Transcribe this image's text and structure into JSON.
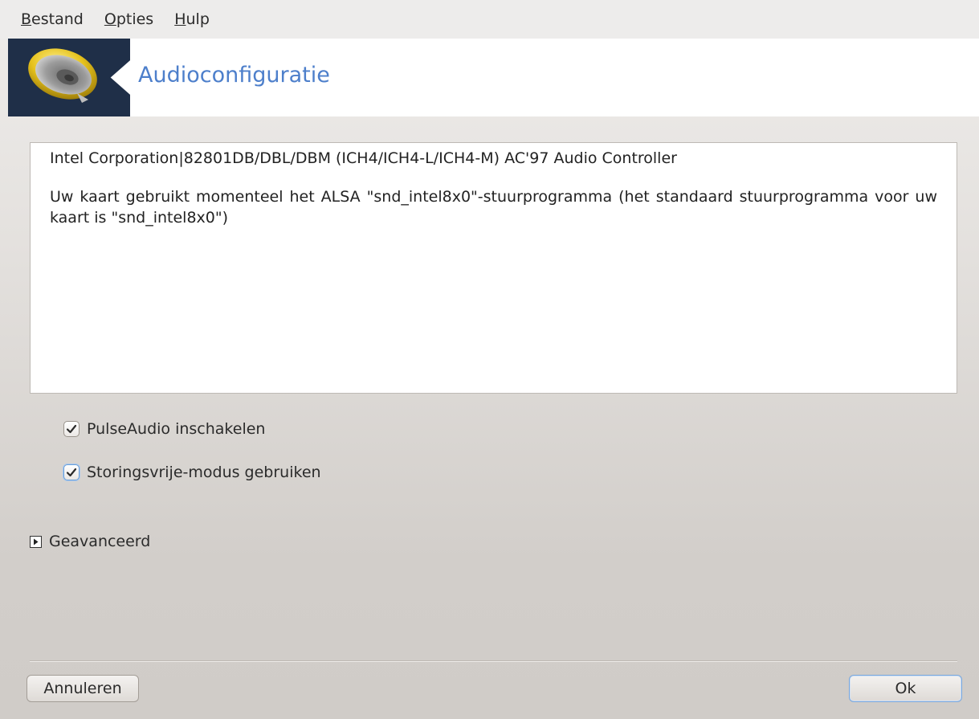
{
  "menubar": {
    "items": [
      {
        "mnemonic": "B",
        "rest": "estand"
      },
      {
        "mnemonic": "O",
        "rest": "pties"
      },
      {
        "mnemonic": "H",
        "rest": "ulp"
      }
    ]
  },
  "header": {
    "title": "Audioconfiguratie",
    "icon": "speaker-icon"
  },
  "info": {
    "card_name": "Intel Corporation|82801DB/DBL/DBM (ICH4/ICH4-L/ICH4-M) AC'97 Audio Controller",
    "description": "Uw kaart gebruikt momenteel het ALSA \"snd_intel8x0\"-stuurprogramma (het standaard stuurprogramma voor uw kaart is \"snd_intel8x0\")"
  },
  "options": {
    "pulseaudio": {
      "label": "PulseAudio inschakelen",
      "checked": true
    },
    "glitchfree": {
      "label": "Storingsvrije-modus gebruiken",
      "checked": true
    }
  },
  "advanced": {
    "label": "Geavanceerd",
    "expanded": false
  },
  "buttons": {
    "cancel": "Annuleren",
    "ok": "Ok"
  }
}
